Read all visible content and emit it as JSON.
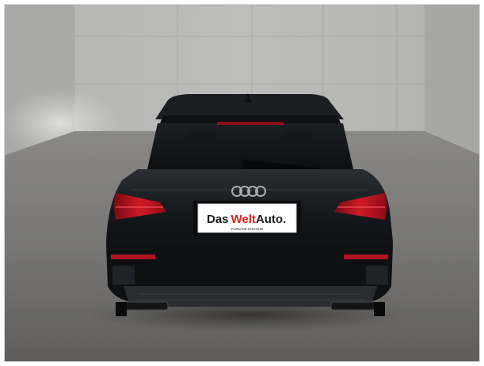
{
  "photo": {
    "subject": "Audi A3 Sportback rear view",
    "body_color": "#121416",
    "wall_color": "#b9b9b7",
    "floor_color": "#7d7c7a",
    "light_color": "#d4d4d2",
    "taillight_color": "#c01220"
  },
  "plate": {
    "das": "Das",
    "welt": "Welt",
    "auto": "Auto.",
    "das_color": "#1a1a1a",
    "welt_color": "#e2231a",
    "auto_color": "#1a1a1a",
    "fine_print": "PORSCHE ZENTRUM"
  },
  "icons": {
    "badge": "audi-rings-icon",
    "antenna": "shark-fin-antenna-icon"
  }
}
